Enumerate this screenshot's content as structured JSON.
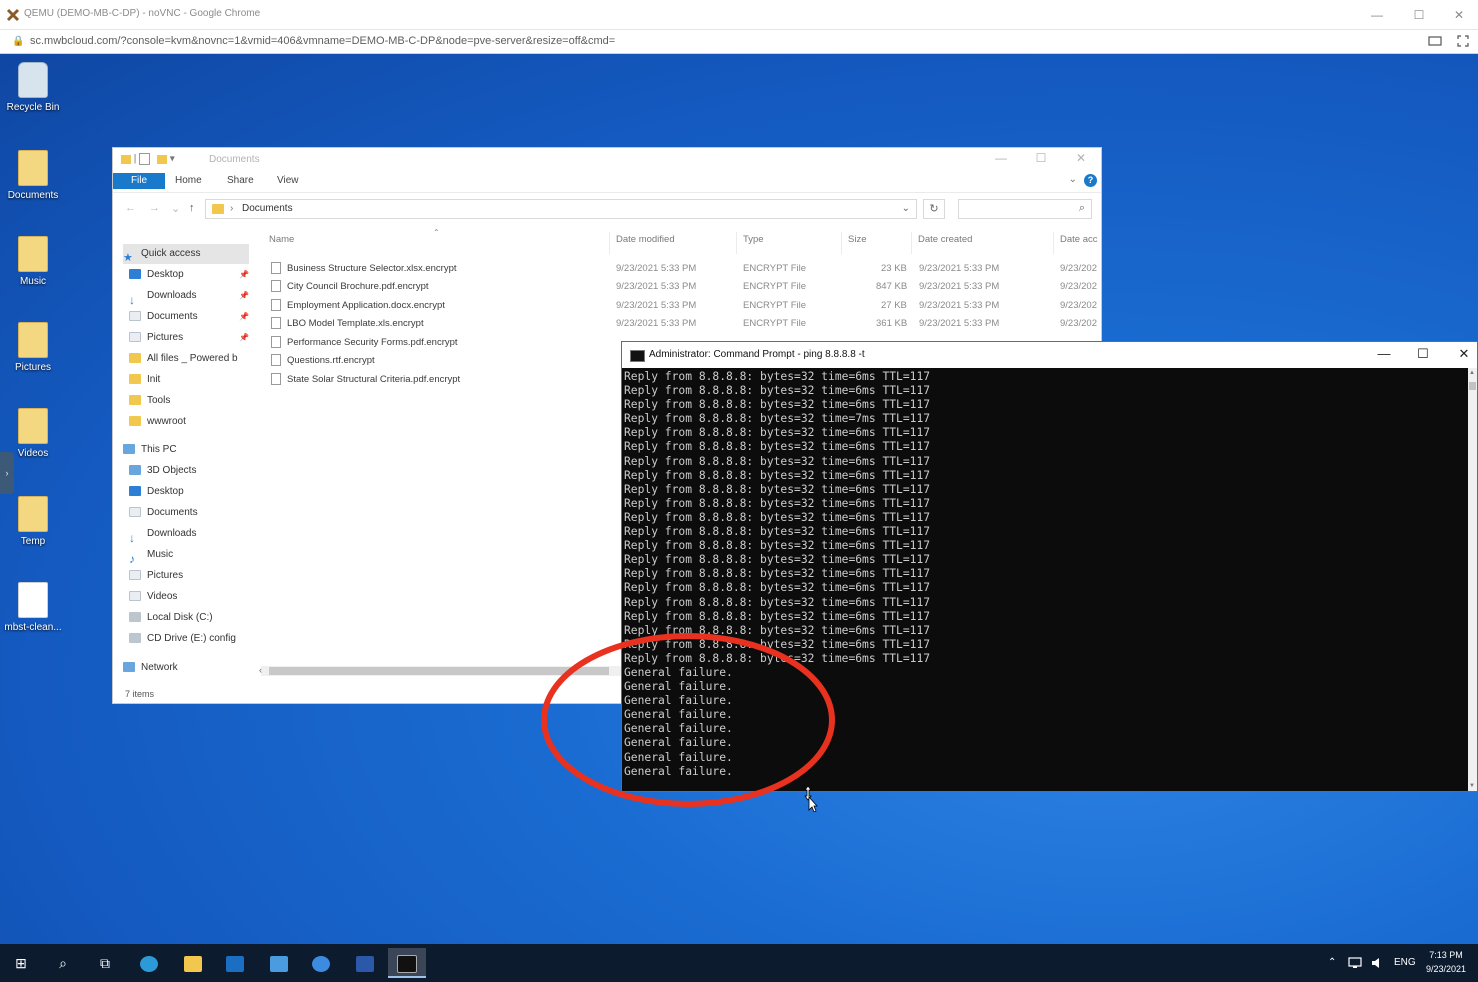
{
  "chrome": {
    "title": "QEMU (DEMO-MB-C-DP) - noVNC - Google Chrome",
    "url": "sc.mwbcloud.com/?console=kvm&novnc=1&vmid=406&vmname=DEMO-MB-C-DP&node=pve-server&resize=off&cmd=",
    "minimize": "—",
    "maximize": "☐",
    "close": "✕"
  },
  "desktop": {
    "icons": [
      {
        "label": "Recycle Bin",
        "kind": "bin"
      },
      {
        "label": "Documents",
        "kind": "folder"
      },
      {
        "label": "Music",
        "kind": "folder"
      },
      {
        "label": "Pictures",
        "kind": "folder"
      },
      {
        "label": "Videos",
        "kind": "folder"
      },
      {
        "label": "Temp",
        "kind": "folder"
      },
      {
        "label": "mbst-clean...",
        "kind": "file"
      }
    ],
    "side_tab": "›"
  },
  "explorer": {
    "title": "Documents",
    "qat_pipe": "|",
    "qat_arrow": "▾",
    "ribbon": {
      "file": "File",
      "home": "Home",
      "share": "Share",
      "view": "View",
      "help": "?",
      "expand": "⌄"
    },
    "nav_buttons": {
      "back": "←",
      "forward": "→",
      "recent": "⌄",
      "up": "↑"
    },
    "address": {
      "sep": "›",
      "path": "Documents",
      "dropdown": "⌄",
      "refresh": "↻"
    },
    "search_icon": "⌕",
    "columns": {
      "name": "Name",
      "date_modified": "Date modified",
      "type": "Type",
      "size": "Size",
      "date_created": "Date created",
      "date_accessed": "Date acc"
    },
    "sort_caret": "⌃",
    "nav": {
      "quick_access": "Quick access",
      "qa_desktop": "Desktop",
      "qa_downloads": "Downloads",
      "qa_documents": "Documents",
      "qa_pictures": "Pictures",
      "qa_allfiles": "All files _ Powered b",
      "qa_init": "Init",
      "qa_tools": "Tools",
      "qa_wwwroot": "wwwroot",
      "this_pc": "This PC",
      "pc_3d": "3D Objects",
      "pc_desktop": "Desktop",
      "pc_documents": "Documents",
      "pc_downloads": "Downloads",
      "pc_music": "Music",
      "pc_pictures": "Pictures",
      "pc_videos": "Videos",
      "pc_local": "Local Disk (C:)",
      "pc_cd": "CD Drive (E:) config",
      "network": "Network",
      "pin": "📌"
    },
    "files": [
      {
        "name": "Business Structure Selector.xlsx.encrypt",
        "modified": "9/23/2021 5:33 PM",
        "type": "ENCRYPT File",
        "size": "23 KB",
        "created": "9/23/2021 5:33 PM",
        "accessed": "9/23/202"
      },
      {
        "name": "City Council Brochure.pdf.encrypt",
        "modified": "9/23/2021 5:33 PM",
        "type": "ENCRYPT File",
        "size": "847 KB",
        "created": "9/23/2021 5:33 PM",
        "accessed": "9/23/202"
      },
      {
        "name": "Employment Application.docx.encrypt",
        "modified": "9/23/2021 5:33 PM",
        "type": "ENCRYPT File",
        "size": "27 KB",
        "created": "9/23/2021 5:33 PM",
        "accessed": "9/23/202"
      },
      {
        "name": "LBO Model Template.xls.encrypt",
        "modified": "9/23/2021 5:33 PM",
        "type": "ENCRYPT File",
        "size": "361 KB",
        "created": "9/23/2021 5:33 PM",
        "accessed": "9/23/202"
      },
      {
        "name": "Performance Security Forms.pdf.encrypt",
        "modified": "",
        "type": "",
        "size": "",
        "created": "",
        "accessed": ""
      },
      {
        "name": "Questions.rtf.encrypt",
        "modified": "",
        "type": "",
        "size": "",
        "created": "",
        "accessed": ""
      },
      {
        "name": "State Solar Structural Criteria.pdf.encrypt",
        "modified": "",
        "type": "",
        "size": "",
        "created": "",
        "accessed": ""
      }
    ],
    "scroll_left": "‹",
    "status": "7 items"
  },
  "cmd": {
    "title": "Administrator: Command Prompt - ping  8.8.8.8 -t",
    "minimize": "—",
    "maximize": "☐",
    "close": "✕",
    "scroll_up": "▲",
    "scroll_down": "▼",
    "lines": [
      "Reply from 8.8.8.8: bytes=32 time=6ms TTL=117",
      "Reply from 8.8.8.8: bytes=32 time=6ms TTL=117",
      "Reply from 8.8.8.8: bytes=32 time=6ms TTL=117",
      "Reply from 8.8.8.8: bytes=32 time=7ms TTL=117",
      "Reply from 8.8.8.8: bytes=32 time=6ms TTL=117",
      "Reply from 8.8.8.8: bytes=32 time=6ms TTL=117",
      "Reply from 8.8.8.8: bytes=32 time=6ms TTL=117",
      "Reply from 8.8.8.8: bytes=32 time=6ms TTL=117",
      "Reply from 8.8.8.8: bytes=32 time=6ms TTL=117",
      "Reply from 8.8.8.8: bytes=32 time=6ms TTL=117",
      "Reply from 8.8.8.8: bytes=32 time=6ms TTL=117",
      "Reply from 8.8.8.8: bytes=32 time=6ms TTL=117",
      "Reply from 8.8.8.8: bytes=32 time=6ms TTL=117",
      "Reply from 8.8.8.8: bytes=32 time=6ms TTL=117",
      "Reply from 8.8.8.8: bytes=32 time=6ms TTL=117",
      "Reply from 8.8.8.8: bytes=32 time=6ms TTL=117",
      "Reply from 8.8.8.8: bytes=32 time=6ms TTL=117",
      "Reply from 8.8.8.8: bytes=32 time=6ms TTL=117",
      "Reply from 8.8.8.8: bytes=32 time=6ms TTL=117",
      "Reply from 8.8.8.8: bytes=32 time=6ms TTL=117",
      "Reply from 8.8.8.8: bytes=32 time=6ms TTL=117",
      "General failure.",
      "General failure.",
      "General failure.",
      "General failure.",
      "General failure.",
      "General failure.",
      "General failure.",
      "General failure."
    ]
  },
  "taskbar": {
    "start": "⊞",
    "search": "⌕",
    "taskview": "⧉",
    "tray_chevron": "⌃",
    "language": "ENG",
    "time": "7:13 PM",
    "date": "9/23/2021"
  },
  "colors": {
    "annotation_circle": "#e8321f",
    "ribbon_file": "#1979ca",
    "desktop": "#1662c4"
  }
}
